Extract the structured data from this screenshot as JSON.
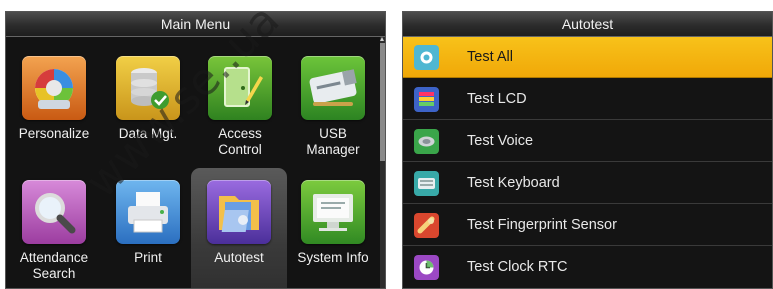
{
  "main_menu": {
    "title": "Main Menu",
    "tiles": [
      {
        "label": "Personalize",
        "icon": "personalize-icon"
      },
      {
        "label": "Data Mgt.",
        "icon": "database-icon"
      },
      {
        "label": "Access\nControl",
        "icon": "access-control-icon"
      },
      {
        "label": "USB\nManager",
        "icon": "usb-icon"
      },
      {
        "label": "Attendance\nSearch",
        "icon": "search-icon"
      },
      {
        "label": "Print",
        "icon": "printer-icon"
      },
      {
        "label": "Autotest",
        "icon": "autotest-folder-icon",
        "selected": true
      },
      {
        "label": "System Info",
        "icon": "system-info-icon"
      }
    ]
  },
  "autotest": {
    "title": "Autotest",
    "items": [
      {
        "label": "Test All",
        "icon": "test-all-icon",
        "active": true
      },
      {
        "label": "Test LCD",
        "icon": "lcd-icon"
      },
      {
        "label": "Test Voice",
        "icon": "voice-icon"
      },
      {
        "label": "Test Keyboard",
        "icon": "keyboard-icon"
      },
      {
        "label": "Test Fingerprint Sensor",
        "icon": "fingerprint-icon"
      },
      {
        "label": "Test Clock RTC",
        "icon": "clock-icon"
      }
    ]
  },
  "colors": {
    "highlight": "#f5b50e",
    "background": "#141414"
  },
  "watermark": "www.se..ua"
}
